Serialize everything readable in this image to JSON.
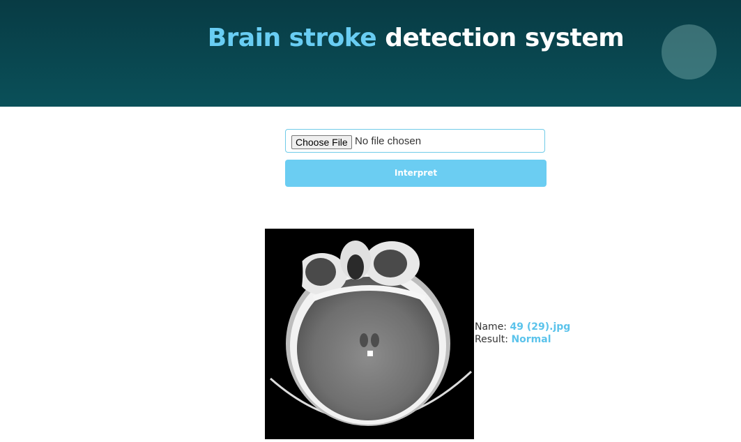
{
  "header": {
    "title_accent": "Brain stroke",
    "title_rest": "detection system"
  },
  "upload": {
    "choose_label": "Choose File",
    "status": "No file chosen",
    "submit_label": "Interpret"
  },
  "result": {
    "name_label": "Name:",
    "name_value": "49 (29).jpg",
    "result_label": "Result:",
    "result_value": "Normal"
  },
  "colors": {
    "header_top": "#083b44",
    "header_bottom": "#0a5059",
    "accent": "#69cdf3"
  }
}
